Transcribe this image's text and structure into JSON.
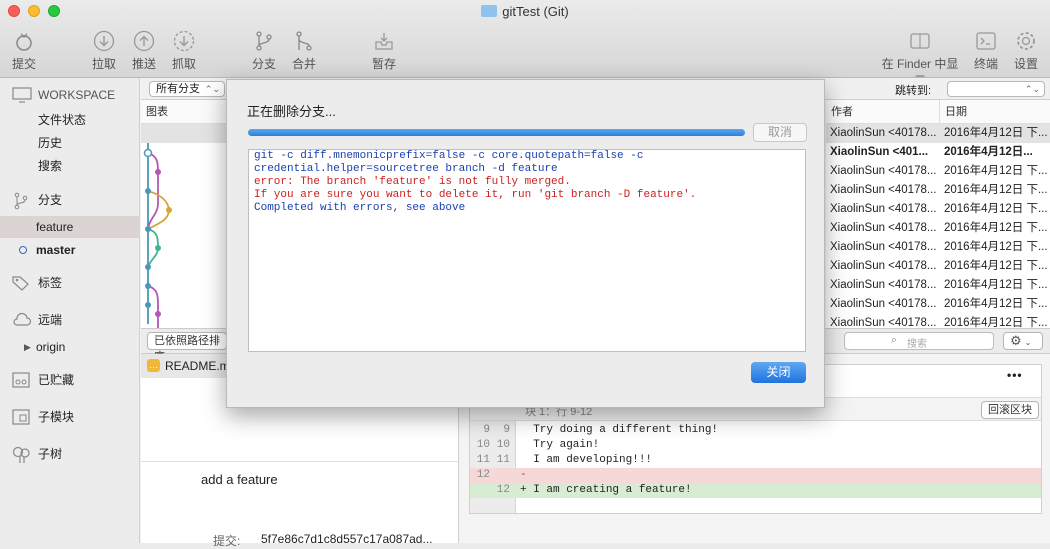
{
  "window": {
    "title": "gitTest (Git)"
  },
  "toolbar": {
    "commit": "提交",
    "pull": "拉取",
    "push": "推送",
    "fetch": "抓取",
    "branch": "分支",
    "merge": "合并",
    "stash": "暂存",
    "finder": "在 Finder 中显示",
    "terminal": "终端",
    "settings": "设置"
  },
  "sidebar": {
    "workspace": "WORKSPACE",
    "file_status": "文件状态",
    "history": "历史",
    "search": "搜索",
    "branches": "分支",
    "branch_feature": "feature",
    "branch_master": "master",
    "tags": "标签",
    "remotes": "远端",
    "origin": "origin",
    "stashes": "已贮藏",
    "submodules": "子模块",
    "subtrees": "子树"
  },
  "filter": {
    "branches_select": "所有分支",
    "jump_label": "跳转到:"
  },
  "columns": {
    "graph": "图表",
    "author": "作者",
    "date": "日期"
  },
  "commits": [
    {
      "author": "XiaolinSun <40178...",
      "date": "2016年4月12日 下..."
    },
    {
      "author": "XiaolinSun <401...",
      "date": "2016年4月12日..."
    },
    {
      "author": "XiaolinSun <40178...",
      "date": "2016年4月12日 下..."
    },
    {
      "author": "XiaolinSun <40178...",
      "date": "2016年4月12日 下..."
    },
    {
      "author": "XiaolinSun <40178...",
      "date": "2016年4月12日 下..."
    },
    {
      "author": "XiaolinSun <40178...",
      "date": "2016年4月12日 下..."
    },
    {
      "author": "XiaolinSun <40178...",
      "date": "2016年4月12日 下..."
    },
    {
      "author": "XiaolinSun <40178...",
      "date": "2016年4月12日 下..."
    },
    {
      "author": "XiaolinSun <40178...",
      "date": "2016年4月12日 下..."
    },
    {
      "author": "XiaolinSun <40178...",
      "date": "2016年4月12日 下..."
    },
    {
      "author": "XiaolinSun <40178...",
      "date": "2016年4月12日 下..."
    }
  ],
  "midbar": {
    "sort_select": "已依照路径排序",
    "search_placeholder": "搜索"
  },
  "files": {
    "readme": "README.md"
  },
  "commit_detail": {
    "message": "add a feature",
    "commit_label": "提交:",
    "hash": "5f7e86c7d1c8d557c17a087ad..."
  },
  "diff": {
    "hunk": "块 1：行 9-12",
    "revert_hunk": "回滚区块",
    "more": "•••",
    "lines": [
      {
        "old": "9",
        "new": "9",
        "text": "  Try doing a different thing!",
        "kind": "ctx"
      },
      {
        "old": "10",
        "new": "10",
        "text": "  Try again!",
        "kind": "ctx"
      },
      {
        "old": "11",
        "new": "11",
        "text": "  I am developing!!!",
        "kind": "ctx"
      },
      {
        "old": "12",
        "new": "",
        "text": "-",
        "kind": "del"
      },
      {
        "old": "",
        "new": "12",
        "text": "+ I am creating a feature!",
        "kind": "add"
      }
    ]
  },
  "dialog": {
    "title": "正在删除分支...",
    "cancel": "取消",
    "close": "关闭",
    "progress": 1.0,
    "log": [
      {
        "text": "git -c diff.mnemonicprefix=false -c core.quotepath=false -c",
        "kind": "cmd"
      },
      {
        "text": "credential.helper=sourcetree branch -d feature",
        "kind": "cmd"
      },
      {
        "text": "error: The branch 'feature' is not fully merged.",
        "kind": "err"
      },
      {
        "text": "If you are sure you want to delete it, run 'git branch -D feature'.",
        "kind": "err"
      },
      {
        "text": "Completed with errors, see above",
        "kind": "cmd"
      }
    ]
  }
}
